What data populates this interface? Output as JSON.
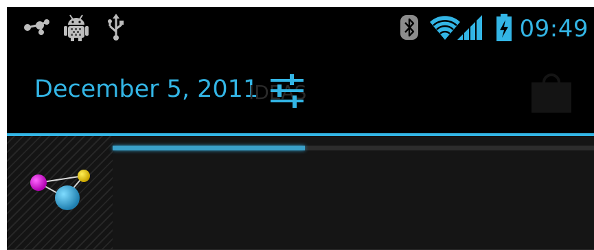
{
  "status_bar": {
    "time": "09:49",
    "left_icons": [
      "share-icon",
      "android-debug-icon",
      "usb-icon"
    ],
    "right_icons": [
      "bluetooth-icon",
      "wifi-icon",
      "cell-signal-icon",
      "battery-charging-icon"
    ]
  },
  "header": {
    "date": "December 5, 2011",
    "settings_icon": "settings-sliders-icon",
    "ghost_text": "IDEAS"
  },
  "notification": {
    "icon": "molecule-app-icon",
    "progress": 0.4
  },
  "colors": {
    "accent": "#33b5e5",
    "background": "#000000"
  }
}
